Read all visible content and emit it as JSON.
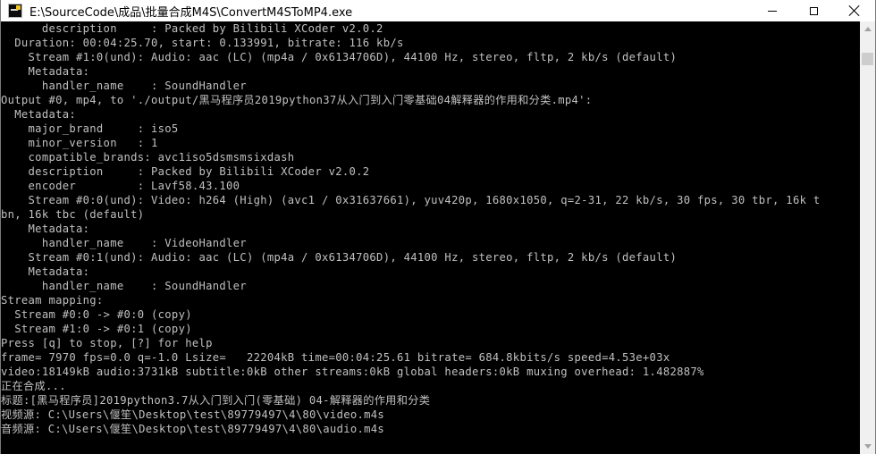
{
  "window": {
    "title": "E:\\SourceCode\\成品\\批量合成M4S\\ConvertM4SToMP4.exe",
    "icon": "console-app-icon"
  },
  "controls": {
    "minimize": "minimize-icon",
    "maximize": "maximize-icon",
    "close": "close-icon"
  },
  "console": {
    "lines": [
      "      description     : Packed by Bilibili XCoder v2.0.2",
      "  Duration: 00:04:25.70, start: 0.133991, bitrate: 116 kb/s",
      "    Stream #1:0(und): Audio: aac (LC) (mp4a / 0x6134706D), 44100 Hz, stereo, fltp, 2 kb/s (default)",
      "    Metadata:",
      "      handler_name    : SoundHandler",
      "Output #0, mp4, to './output/黑马程序员2019python37从入门到入门零基础04解释器的作用和分类.mp4':",
      "  Metadata:",
      "    major_brand     : iso5",
      "    minor_version   : 1",
      "    compatible_brands: avc1iso5dsmsmsixdash",
      "    description     : Packed by Bilibili XCoder v2.0.2",
      "    encoder         : Lavf58.43.100",
      "    Stream #0:0(und): Video: h264 (High) (avc1 / 0x31637661), yuv420p, 1680x1050, q=2-31, 22 kb/s, 30 fps, 30 tbr, 16k t",
      "bn, 16k tbc (default)",
      "    Metadata:",
      "      handler_name    : VideoHandler",
      "    Stream #0:1(und): Audio: aac (LC) (mp4a / 0x6134706D), 44100 Hz, stereo, fltp, 2 kb/s (default)",
      "    Metadata:",
      "      handler_name    : SoundHandler",
      "Stream mapping:",
      "  Stream #0:0 -> #0:0 (copy)",
      "  Stream #1:0 -> #0:1 (copy)",
      "Press [q] to stop, [?] for help",
      "frame= 7970 fps=0.0 q=-1.0 Lsize=   22204kB time=00:04:25.61 bitrate= 684.8kbits/s speed=4.53e+03x",
      "video:18149kB audio:3731kB subtitle:0kB other streams:0kB global headers:0kB muxing overhead: 1.482887%",
      "正在合成...",
      "标题:[黑马程序员]2019python3.7从入门到入门(零基础) 04-解释器的作用和分类",
      "视频源: C:\\Users\\偃笙\\Desktop\\test\\89779497\\4\\80\\video.m4s",
      "音频源: C:\\Users\\偃笙\\Desktop\\test\\89779497\\4\\80\\audio.m4s"
    ]
  },
  "scrollbar": {
    "up": "scroll-up-arrow-icon",
    "down": "scroll-down-arrow-icon"
  }
}
